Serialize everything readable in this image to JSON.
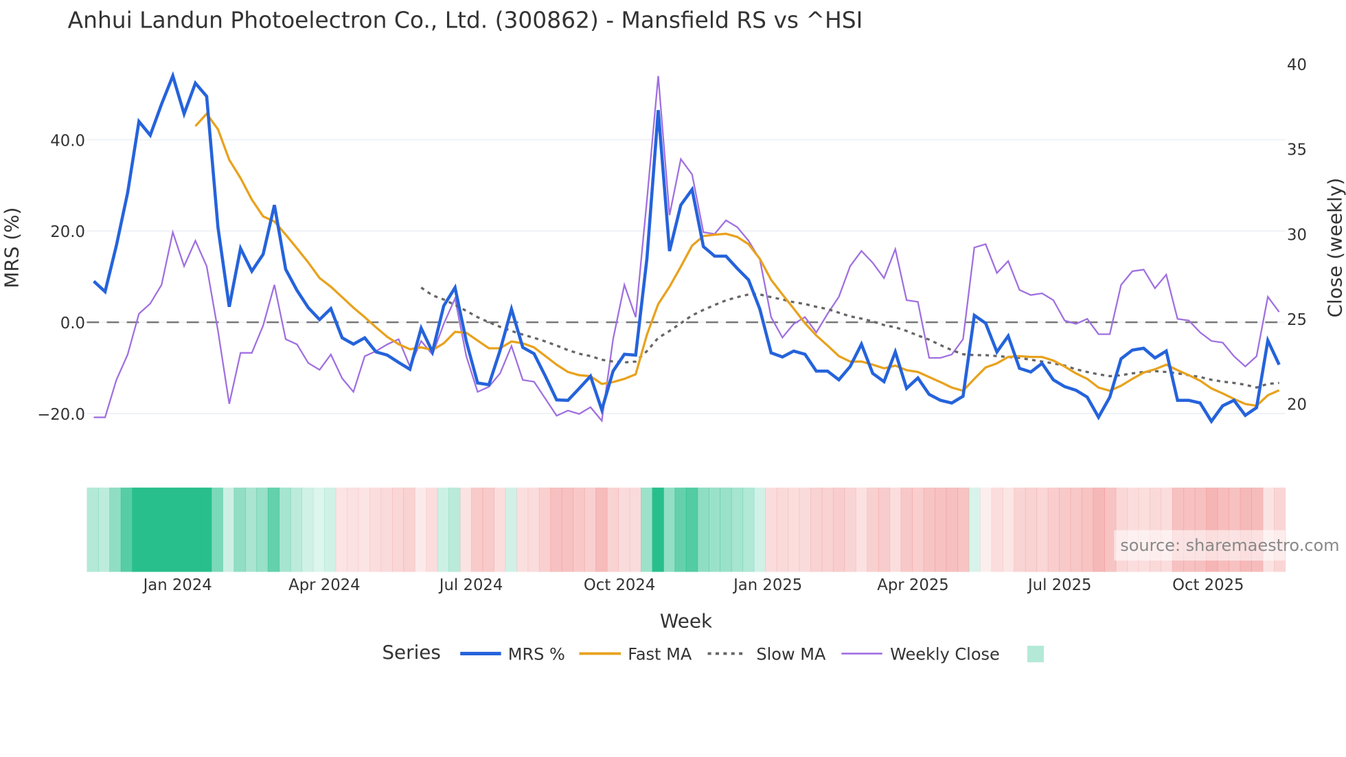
{
  "chart_data": {
    "type": "line",
    "title": "Anhui Landun Photoelectron Co., Ltd. (300862) - Mansfield RS vs ^HSI",
    "xlabel": "Week",
    "ylabel": "MRS (%)",
    "y2label": "Close (weekly)",
    "x_start": "2023-11-10",
    "x_step_days": 7,
    "ylim": [
      -22.7,
      59.2
    ],
    "y2lim": [
      18.7,
      40.7
    ],
    "y_ticks": [
      {
        "value": -20,
        "label": "−20.0"
      },
      {
        "value": 0,
        "label": "0.0"
      },
      {
        "value": 20,
        "label": "20.0"
      },
      {
        "value": 40,
        "label": "40.0"
      }
    ],
    "y2_ticks": [
      {
        "value": 20,
        "label": "20"
      },
      {
        "value": 25,
        "label": "25"
      },
      {
        "value": 30,
        "label": "30"
      },
      {
        "value": 35,
        "label": "35"
      },
      {
        "value": 40,
        "label": "40"
      }
    ],
    "x_ticks": [
      {
        "date": "2024-01-01",
        "label": "Jan 2024"
      },
      {
        "date": "2024-04-01",
        "label": "Apr 2024"
      },
      {
        "date": "2024-07-01",
        "label": "Jul 2024"
      },
      {
        "date": "2024-10-01",
        "label": "Oct 2024"
      },
      {
        "date": "2025-01-01",
        "label": "Jan 2025"
      },
      {
        "date": "2025-04-01",
        "label": "Apr 2025"
      },
      {
        "date": "2025-07-01",
        "label": "Jul 2025"
      },
      {
        "date": "2025-10-01",
        "label": "Oct 2025"
      }
    ],
    "zero_line": 0,
    "grid": true,
    "legend_title": "Series",
    "legend_position": "bottom",
    "series": [
      {
        "name": "MRS %",
        "axis": "y",
        "color": "#2563db",
        "style": "solid",
        "values": [
          9,
          6.7,
          16.8,
          28.4,
          44,
          41,
          47.8,
          54,
          45.7,
          52.4,
          49.5,
          20.8,
          3.4,
          16.2,
          11.2,
          14.9,
          25.7,
          11.6,
          7,
          3.2,
          0.6,
          3,
          -3.4,
          -4.8,
          -3.4,
          -6.5,
          -7.2,
          -8.8,
          -10.3,
          -1.3,
          -6.5,
          3.6,
          7.6,
          -4.2,
          -13.3,
          -13.7,
          -6.1,
          2.9,
          -5.5,
          -6.9,
          -11.8,
          -17,
          -17.1,
          -14.5,
          -11.8,
          -19.2,
          -10.7,
          -7,
          -7.2,
          14,
          46.5,
          15.6,
          25.7,
          29.1,
          16.6,
          14.5,
          14.5,
          11.8,
          9.3,
          2.9,
          -6.7,
          -7.6,
          -6.3,
          -7,
          -10.7,
          -10.7,
          -12.6,
          -9.7,
          -4.8,
          -11.2,
          -13,
          -6.5,
          -14.5,
          -12.2,
          -15.8,
          -17.1,
          -17.7,
          -16.2,
          1.5,
          -0.2,
          -6.5,
          -3,
          -10.1,
          -10.9,
          -9,
          -12.6,
          -14.1,
          -14.9,
          -16.4,
          -20.8,
          -16.4,
          -8,
          -6.1,
          -5.7,
          -7.8,
          -6.3,
          -17.1,
          -17.1,
          -17.7,
          -21.7,
          -18.3,
          -17.1,
          -20.4,
          -18.7,
          -4,
          -9.3
        ]
      },
      {
        "name": "Fast MA",
        "axis": "y",
        "color": "#e8a21e",
        "style": "solid",
        "values": [
          null,
          null,
          null,
          null,
          null,
          null,
          null,
          null,
          null,
          43,
          45.7,
          42.3,
          35.6,
          31.6,
          26.9,
          23.2,
          22.1,
          19.2,
          16.2,
          13.1,
          9.7,
          7.8,
          5.5,
          3.2,
          1.1,
          -1.1,
          -3.2,
          -4.8,
          -5.9,
          -5.5,
          -6.1,
          -4.6,
          -2.1,
          -2.3,
          -4,
          -5.7,
          -5.7,
          -4.2,
          -4.6,
          -5.5,
          -7.4,
          -9.3,
          -10.9,
          -11.6,
          -11.8,
          -13.5,
          -13.1,
          -12.4,
          -11.4,
          -2.7,
          4,
          7.8,
          12.2,
          16.8,
          18.9,
          19.2,
          19.4,
          18.7,
          17.1,
          13.9,
          9.3,
          6.1,
          3,
          -0.2,
          -2.9,
          -5.1,
          -7.4,
          -8.6,
          -8.6,
          -9.3,
          -10.1,
          -9.5,
          -10.5,
          -10.9,
          -12,
          -13.1,
          -14.3,
          -15,
          -12.4,
          -9.9,
          -9,
          -7.6,
          -7.4,
          -7.6,
          -7.6,
          -8.4,
          -9.7,
          -11.2,
          -12.4,
          -14.3,
          -15,
          -13.9,
          -12.4,
          -11,
          -10.3,
          -9.3,
          -10.5,
          -11.6,
          -12.8,
          -14.5,
          -15.6,
          -16.8,
          -17.9,
          -18.3,
          -16,
          -14.9
        ]
      },
      {
        "name": "Slow MA",
        "axis": "y",
        "color": "#666666",
        "style": "dot",
        "values": [
          null,
          null,
          null,
          null,
          null,
          null,
          null,
          null,
          null,
          null,
          null,
          null,
          null,
          null,
          null,
          null,
          null,
          null,
          null,
          null,
          null,
          null,
          null,
          null,
          null,
          null,
          null,
          null,
          null,
          7.6,
          5.9,
          5,
          3.8,
          2.5,
          1.1,
          0,
          -1,
          -1.9,
          -2.7,
          -3.4,
          -4.2,
          -5.1,
          -6.1,
          -6.9,
          -7.4,
          -8.2,
          -8.6,
          -8.8,
          -8.6,
          -6.3,
          -3.4,
          -1.9,
          -0.2,
          1.5,
          2.7,
          3.8,
          4.8,
          5.5,
          6.1,
          6.1,
          5.5,
          5,
          4.4,
          4,
          3.4,
          2.9,
          2.1,
          1.3,
          0.8,
          0.2,
          -0.6,
          -1.1,
          -1.9,
          -2.9,
          -3.8,
          -5,
          -6.1,
          -7,
          -7.2,
          -7.2,
          -7.4,
          -7.6,
          -7.8,
          -8.2,
          -8.6,
          -9,
          -9.5,
          -10.3,
          -10.9,
          -11.4,
          -11.8,
          -11.6,
          -11.2,
          -10.9,
          -10.7,
          -10.9,
          -11.2,
          -11.6,
          -12,
          -12.6,
          -13,
          -13.3,
          -13.7,
          -14.3,
          -13.5,
          -13.3
        ]
      },
      {
        "name": "Weekly Close",
        "axis": "y2",
        "color": "#a06fe0",
        "style": "solid",
        "values": [
          19.2,
          19.2,
          21.4,
          22.9,
          25.3,
          25.9,
          27,
          30.1,
          28.1,
          29.6,
          28.1,
          24.3,
          20,
          23,
          23,
          24.6,
          27,
          23.8,
          23.5,
          22.4,
          22,
          22.9,
          21.5,
          20.7,
          22.8,
          23.1,
          23.5,
          23.8,
          22.2,
          23.7,
          22.9,
          24.7,
          26.2,
          22.8,
          20.7,
          21,
          21.8,
          23.4,
          21.4,
          21.3,
          20.3,
          19.3,
          19.6,
          19.4,
          19.8,
          19,
          23.8,
          27,
          25.1,
          32,
          39.3,
          31.1,
          34.4,
          33.5,
          30.1,
          30,
          30.8,
          30.4,
          29.6,
          28.5,
          25.1,
          23.9,
          24.7,
          25.1,
          24.2,
          25.3,
          26.3,
          28.1,
          29,
          28.3,
          27.4,
          29.1,
          26.1,
          26,
          22.7,
          22.7,
          22.9,
          23.8,
          29.2,
          29.4,
          27.7,
          28.4,
          26.7,
          26.4,
          26.5,
          26.1,
          24.9,
          24.7,
          25,
          24.1,
          24.1,
          27,
          27.8,
          27.9,
          26.8,
          27.6,
          25,
          24.9,
          24.2,
          23.7,
          23.6,
          22.8,
          22.2,
          22.8,
          26.3,
          25.4
        ]
      }
    ],
    "heatmap": {
      "source_series": "MRS %",
      "positive_color": "#28bf8c",
      "negative_color": "#f08a8a"
    },
    "source_note": "source: sharemaestro.com"
  }
}
